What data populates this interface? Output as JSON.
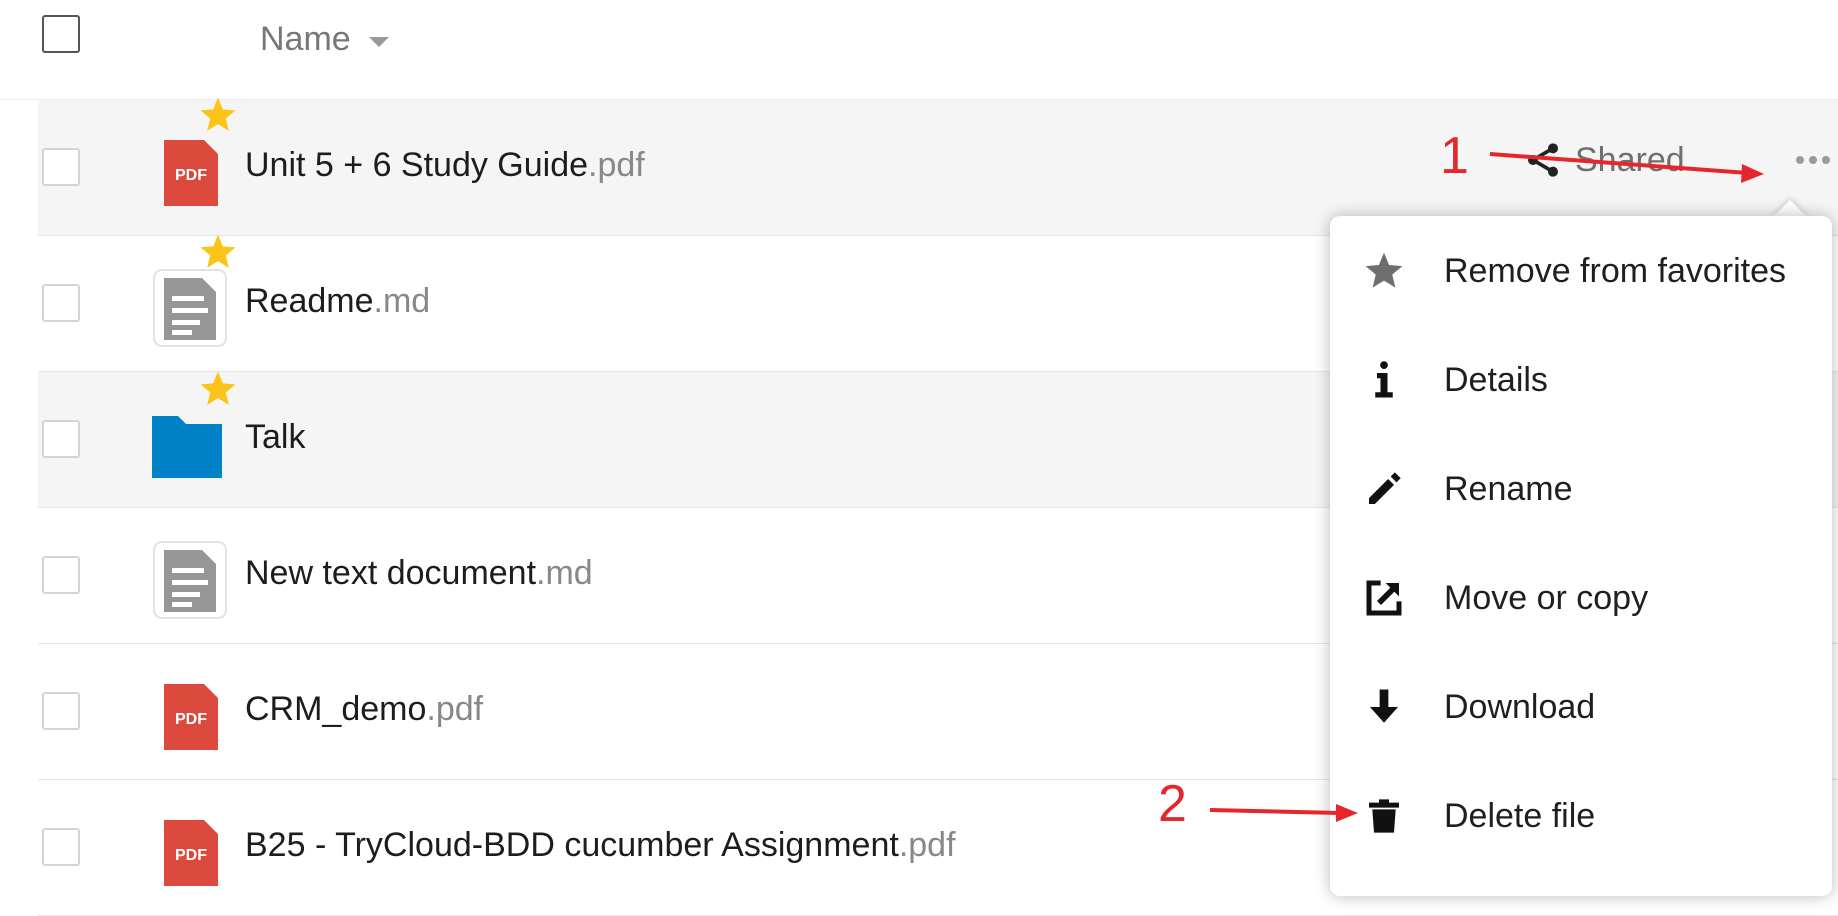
{
  "header": {
    "name_label": "Name"
  },
  "files": [
    {
      "base": "Unit 5 + 6 Study Guide",
      "ext": ".pdf",
      "type": "pdf",
      "favorite": true,
      "shared_label": "Shared",
      "highlighted": true
    },
    {
      "base": "Readme",
      "ext": ".md",
      "type": "text",
      "favorite": true,
      "highlighted": false
    },
    {
      "base": "Talk",
      "ext": "",
      "type": "folder",
      "favorite": true,
      "highlighted": true
    },
    {
      "base": "New text document",
      "ext": ".md",
      "type": "text",
      "favorite": false,
      "highlighted": false
    },
    {
      "base": "CRM_demo",
      "ext": ".pdf",
      "type": "pdf",
      "favorite": false,
      "highlighted": false
    },
    {
      "base": "B25 - TryCloud-BDD cucumber Assignment",
      "ext": ".pdf",
      "type": "pdf",
      "favorite": false,
      "highlighted": false
    }
  ],
  "pdf_badge": "PDF",
  "menu": {
    "items": [
      {
        "label": "Remove from favorites",
        "icon": "star-icon"
      },
      {
        "label": "Details",
        "icon": "info-icon"
      },
      {
        "label": "Rename",
        "icon": "pencil-icon"
      },
      {
        "label": "Move or copy",
        "icon": "external-link-icon"
      },
      {
        "label": "Download",
        "icon": "download-arrow-icon"
      },
      {
        "label": "Delete file",
        "icon": "trash-icon"
      }
    ]
  },
  "annotations": {
    "step1": "1",
    "step2": "2"
  },
  "colors": {
    "pdf": "#dc4a3d",
    "folder": "#0082c9",
    "star": "#fcc418",
    "annotation": "#e5262b"
  }
}
